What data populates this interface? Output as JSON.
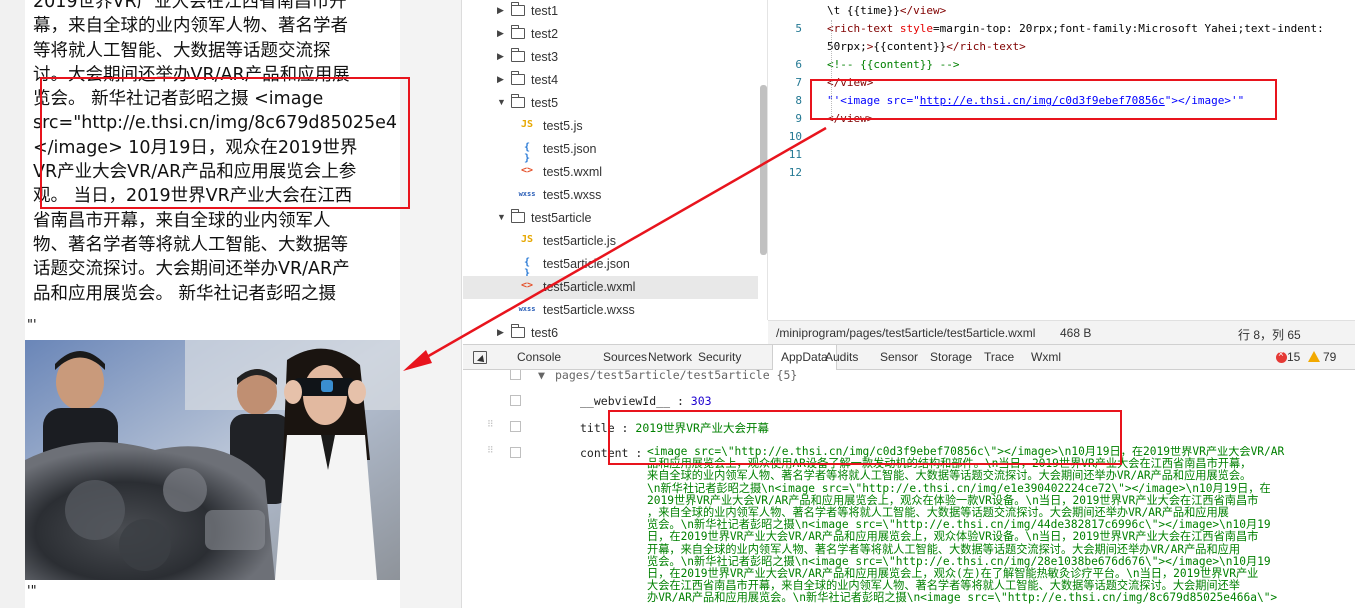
{
  "simulator": {
    "article_lines": [
      "2019世界VR产业大会在江西省南昌市开",
      "幕，来自全球的业内领军人物、著名学者",
      "等将就人工智能、大数据等话题交流探",
      "讨。大会期间还举办VR/AR产品和应用展",
      "览会。 新华社记者彭昭之摄 <image",
      "src=\"http://e.thsi.cn/img/8c679d85025e4",
      "</image> 10月19日，观众在2019世界",
      "VR产业大会VR/AR产品和应用展览会上参",
      "观。 当日，2019世界VR产业大会在江西",
      "省南昌市开幕，来自全球的业内领军人",
      "物、著名学者等将就人工智能、大数据等",
      "话题交流探讨。大会期间还举办VR/AR产",
      "品和应用展览会。 新华社记者彭昭之摄"
    ],
    "quote_after_text": "\"'",
    "quote_after_image": "'\""
  },
  "file_tree": {
    "items": [
      {
        "type": "folder",
        "label": "test1",
        "expanded": false,
        "depth": 0
      },
      {
        "type": "folder",
        "label": "test2",
        "expanded": false,
        "depth": 0
      },
      {
        "type": "folder",
        "label": "test3",
        "expanded": false,
        "depth": 0
      },
      {
        "type": "folder",
        "label": "test4",
        "expanded": false,
        "depth": 0
      },
      {
        "type": "folder",
        "label": "test5",
        "expanded": true,
        "depth": 0
      },
      {
        "type": "js",
        "label": "test5.js",
        "icon": "JS",
        "depth": 1
      },
      {
        "type": "json",
        "label": "test5.json",
        "icon": "{ }",
        "depth": 1
      },
      {
        "type": "wxml",
        "label": "test5.wxml",
        "icon": "<>",
        "depth": 1
      },
      {
        "type": "wxss",
        "label": "test5.wxss",
        "icon": "wxss",
        "depth": 1
      },
      {
        "type": "folder",
        "label": "test5article",
        "expanded": true,
        "depth": 0
      },
      {
        "type": "js",
        "label": "test5article.js",
        "icon": "JS",
        "depth": 1
      },
      {
        "type": "json",
        "label": "test5article.json",
        "icon": "{ }",
        "depth": 1
      },
      {
        "type": "wxml",
        "label": "test5article.wxml",
        "icon": "<>",
        "depth": 1,
        "selected": true
      },
      {
        "type": "wxss",
        "label": "test5article.wxss",
        "icon": "wxss",
        "depth": 1
      },
      {
        "type": "folder",
        "label": "test6",
        "expanded": false,
        "depth": 0
      }
    ]
  },
  "editor": {
    "lines": [
      {
        "num": "",
        "text": "\\t {{time}}</view>"
      },
      {
        "num": "5",
        "text": "  <rich-text style=\"margin-top: 20rpx;font-family:Microsoft Yahei;text-indent:"
      },
      {
        "num": "",
        "text": "50rpx;\">{{content}}</rich-text>"
      },
      {
        "num": "6",
        "text": "  <!-- {{content}} -->"
      },
      {
        "num": "7",
        "text": "  </view>"
      },
      {
        "num": "8",
        "text_pre": "  \"'<image src=\"",
        "text_link": "http://e.thsi.cn/img/c0d3f9ebef70856c",
        "text_post": "\"></image>'\""
      },
      {
        "num": "9",
        "text": "</view>"
      },
      {
        "num": "10",
        "text": ""
      },
      {
        "num": "11",
        "text": ""
      },
      {
        "num": "12",
        "text": ""
      }
    ]
  },
  "statusbar": {
    "path": "/miniprogram/pages/test5article/test5article.wxml",
    "size": "468 B",
    "cursor": "行 8，列 65"
  },
  "devtools": {
    "tabs": [
      "Console",
      "Sources",
      "Network",
      "Security",
      "AppData",
      "Audits",
      "Sensor",
      "Storage",
      "Trace",
      "Wxml"
    ],
    "active_tab": "AppData",
    "error_count": "15",
    "warning_count": "79"
  },
  "appdata": {
    "path_row": "pages/test5article/test5article {5}",
    "webviewId_key": "__webviewId__",
    "webviewId_value": "303",
    "title_key": "title",
    "title_value": "2019世界VR产业大会开幕",
    "content_key": "content",
    "content_lines": [
      "<image src=\\\"http://e.thsi.cn/img/c0d3f9ebef70856c\\\"></image>\\n10月19日，在2019世界VR产业大会VR/AR",
      "品和应用展览会上，观众使用AR设备了解一款发动机的结构和部件。\\n当日，2019世界VR产业大会在江西省南昌市开幕，",
      "来自全球的业内领军人物、著名学者等将就人工智能、大数据等话题交流探讨。大会期间还举办VR/AR产品和应用展览会。",
      "\\n新华社记者彭昭之摄\\n<image src=\\\"http://e.thsi.cn/img/e1e390402224ce72\\\"></image>\\n10月19日，在",
      "2019世界VR产业大会VR/AR产品和应用展览会上，观众在体验一款VR设备。\\n当日，2019世界VR产业大会在江西省南昌市",
      "，来自全球的业内领军人物、著名学者等将就人工智能、大数据等话题交流探讨。大会期间还举办VR/AR产品和应用展",
      "览会。\\n新华社记者彭昭之摄\\n<image src=\\\"http://e.thsi.cn/img/44de382817c6996c\\\"></image>\\n10月19",
      "日，在2019世界VR产业大会VR/AR产品和应用展览会上，观众体验VR设备。\\n当日，2019世界VR产业大会在江西省南昌市",
      "开幕，来自全球的业内领军人物、著名学者等将就人工智能、大数据等话题交流探讨。大会期间还举办VR/AR产品和应用",
      "览会。\\n新华社记者彭昭之摄\\n<image src=\\\"http://e.thsi.cn/img/28e1038be676d676\\\"></image>\\n10月19",
      "日，在2019世界VR产业大会VR/AR产品和应用展览会上，观众(左)在了解智能热敏灸诊疗平台。\\n当日，2019世界VR产业",
      "大会在江西省南昌市开幕，来自全球的业内领军人物、著名学者等将就人工智能、大数据等话题交流探讨。大会期间还举",
      "办VR/AR产品和应用展览会。\\n新华社记者彭昭之摄\\n<image src=\\\"http://e.thsi.cn/img/8c679d85025e466a\\\">"
    ]
  },
  "colors": {
    "annotation_red": "#e8141d",
    "code_tag": "#800000",
    "code_attr": "#e50000",
    "code_string": "#0000ff",
    "code_comment": "#008000",
    "appdata_string": "#008000",
    "appdata_number": "#1c00cf"
  }
}
